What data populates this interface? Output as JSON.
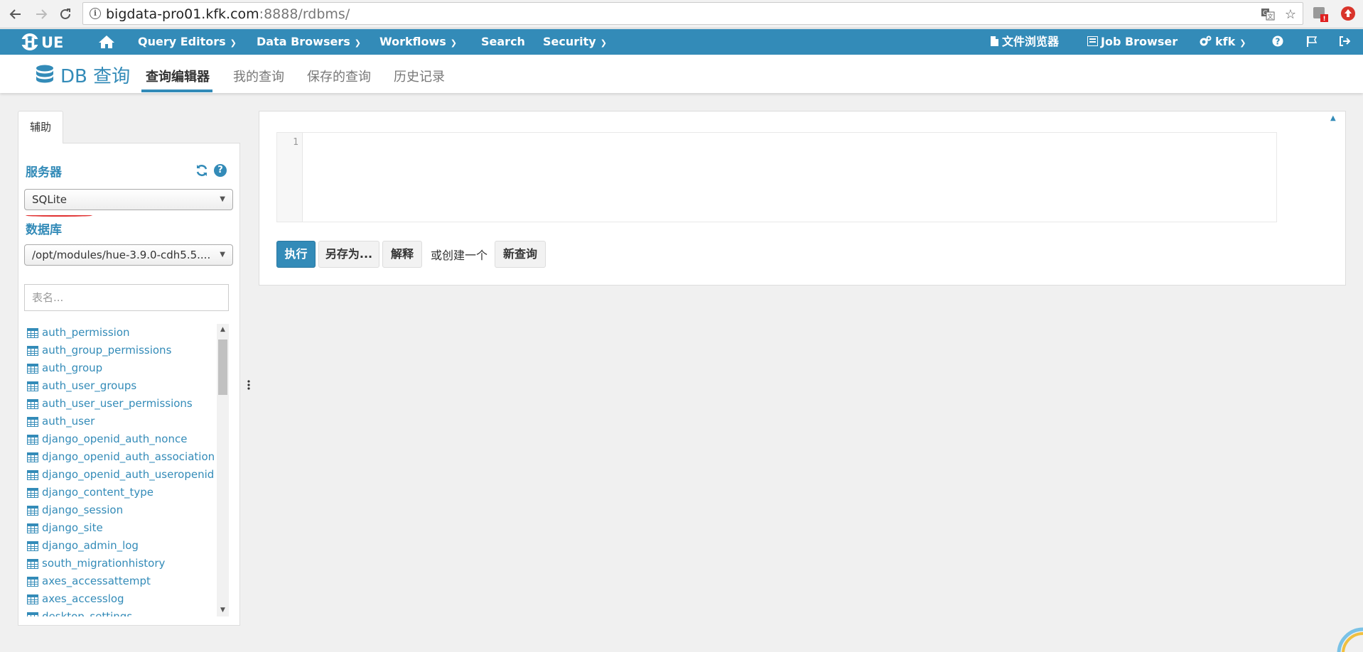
{
  "browser": {
    "back_icon": "arrow-left-icon",
    "forward_icon": "arrow-right-icon",
    "reload_icon": "reload-icon",
    "url_host": "bigdata-pro01.kfk.com",
    "url_rest": ":8888/rdbms/",
    "translate_icon": "translate-icon",
    "bookmark_icon": "star-icon"
  },
  "topbar": {
    "logo_text": "HUE",
    "query_editors": "Query Editors",
    "data_browsers": "Data Browsers",
    "workflows": "Workflows",
    "search": "Search",
    "security": "Security",
    "file_browser": "文件浏览器",
    "job_browser": "Job Browser",
    "user": "kfk"
  },
  "subnav": {
    "app_title": "DB 查询",
    "tabs": [
      "查询编辑器",
      "我的查询",
      "保存的查询",
      "历史记录"
    ],
    "active_tab": 0
  },
  "left_panel": {
    "tab_label": "辅助",
    "server_label": "服务器",
    "server_value": "SQLite",
    "database_label": "数据库",
    "database_value": "/opt/modules/hue-3.9.0-cdh5.5....",
    "search_placeholder": "表名...",
    "tables": [
      "auth_permission",
      "auth_group_permissions",
      "auth_group",
      "auth_user_groups",
      "auth_user_user_permissions",
      "auth_user",
      "django_openid_auth_nonce",
      "django_openid_auth_association",
      "django_openid_auth_useropenid",
      "django_content_type",
      "django_session",
      "django_site",
      "django_admin_log",
      "south_migrationhistory",
      "axes_accessattempt",
      "axes_accesslog",
      "desktop_settings"
    ]
  },
  "editor": {
    "line_number": "1",
    "execute": "执行",
    "save_as": "另存为...",
    "explain": "解释",
    "or_create": "或创建一个",
    "new_query": "新查询"
  },
  "colors": {
    "brand": "#338bb8",
    "background": "#f0f0f0"
  }
}
